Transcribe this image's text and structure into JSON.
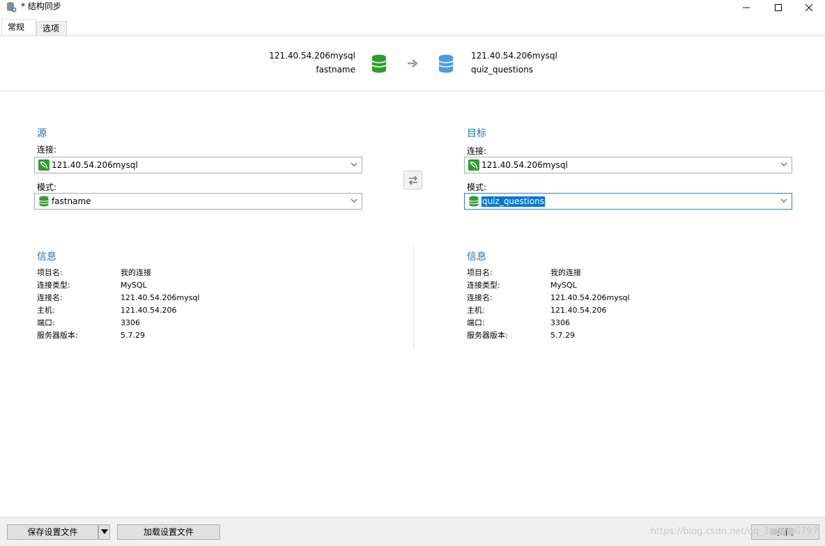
{
  "window": {
    "title": "* 结构同步"
  },
  "tabs": [
    {
      "label": "常规"
    },
    {
      "label": "选项"
    }
  ],
  "summary": {
    "source_connection": "121.40.54.206mysql",
    "source_schema": "fastname",
    "target_connection": "121.40.54.206mysql",
    "target_schema": "quiz_questions"
  },
  "source": {
    "title": "源",
    "connection_label": "连接:",
    "connection_value": "121.40.54.206mysql",
    "schema_label": "模式:",
    "schema_value": "fastname"
  },
  "target": {
    "title": "目标",
    "connection_label": "连接:",
    "connection_value": "121.40.54.206mysql",
    "schema_label": "模式:",
    "schema_value": "quiz_questions"
  },
  "source_info": {
    "title": "信息",
    "rows": [
      {
        "key": "项目名:",
        "value": "我的连接"
      },
      {
        "key": "连接类型:",
        "value": "MySQL"
      },
      {
        "key": "连接名:",
        "value": "121.40.54.206mysql"
      },
      {
        "key": "主机:",
        "value": "121.40.54.206"
      },
      {
        "key": "端口:",
        "value": "3306"
      },
      {
        "key": "服务器版本:",
        "value": "5.7.29"
      }
    ]
  },
  "target_info": {
    "title": "信息",
    "rows": [
      {
        "key": "项目名:",
        "value": "我的连接"
      },
      {
        "key": "连接类型:",
        "value": "MySQL"
      },
      {
        "key": "连接名:",
        "value": "121.40.54.206mysql"
      },
      {
        "key": "主机:",
        "value": "121.40.54.206"
      },
      {
        "key": "端口:",
        "value": "3306"
      },
      {
        "key": "服务器版本:",
        "value": "5.7.29"
      }
    ]
  },
  "buttons": {
    "save_settings": "保存设置文件",
    "load_settings": "加载设置文件",
    "close": "关闭"
  },
  "watermark": "https://blog.csdn.net/qq_3■■■6797",
  "colors": {
    "source_db": "#2e9e2e",
    "target_db": "#4a9be8",
    "section_title": "#1f6fb2",
    "selection": "#0078d7"
  }
}
